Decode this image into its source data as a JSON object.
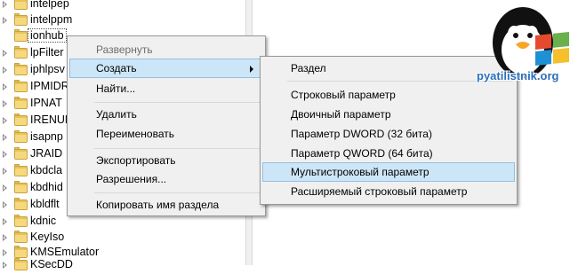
{
  "tree": {
    "items": [
      {
        "label": "intelpep",
        "expander": "collapsed"
      },
      {
        "label": "intelppm",
        "expander": "collapsed"
      },
      {
        "label": "ionhub",
        "expander": "collapsed",
        "selected": true
      },
      {
        "label": "lpFilter",
        "expander": "collapsed"
      },
      {
        "label": "iphlpsv",
        "expander": "collapsed"
      },
      {
        "label": "IPMIDR",
        "expander": "collapsed"
      },
      {
        "label": "IPNAT",
        "expander": "collapsed"
      },
      {
        "label": "IRENUM",
        "expander": "collapsed"
      },
      {
        "label": "isapnp",
        "expander": "collapsed"
      },
      {
        "label": "JRAID",
        "expander": "collapsed"
      },
      {
        "label": "kbdcla",
        "expander": "collapsed"
      },
      {
        "label": "kbdhid",
        "expander": "collapsed"
      },
      {
        "label": "kbldflt",
        "expander": "collapsed"
      },
      {
        "label": "kdnic",
        "expander": "collapsed"
      },
      {
        "label": "KeyIso",
        "expander": "collapsed"
      },
      {
        "label": "KMSEmulator",
        "expander": "collapsed"
      },
      {
        "label": "KSecDD",
        "expander": "collapsed"
      }
    ]
  },
  "context_menu": {
    "items": [
      {
        "label": "Развернуть",
        "disabled": true
      },
      {
        "label": "Создать",
        "hover": true,
        "has_submenu": true
      },
      {
        "label": "Найти..."
      },
      {
        "separator": true
      },
      {
        "label": "Удалить"
      },
      {
        "label": "Переименовать"
      },
      {
        "separator": true
      },
      {
        "label": "Экспортировать"
      },
      {
        "label": "Разрешения..."
      },
      {
        "separator": true
      },
      {
        "label": "Копировать имя раздела"
      }
    ]
  },
  "submenu": {
    "items": [
      {
        "label": "Раздел"
      },
      {
        "separator": true
      },
      {
        "label": "Строковый параметр"
      },
      {
        "label": "Двоичный параметр"
      },
      {
        "label": "Параметр DWORD (32 бита)"
      },
      {
        "label": "Параметр QWORD (64 бита)"
      },
      {
        "label": "Мультистроковый параметр",
        "hover": true
      },
      {
        "label": "Расширяемый строковый параметр"
      }
    ]
  },
  "watermark": {
    "text": "pyatilistnik.org",
    "colors": {
      "text": "#2b6fb8",
      "flag_red": "#e64a2e",
      "flag_green": "#6ab04c",
      "flag_blue": "#1e90d6",
      "flag_yellow": "#f6c02c"
    }
  }
}
